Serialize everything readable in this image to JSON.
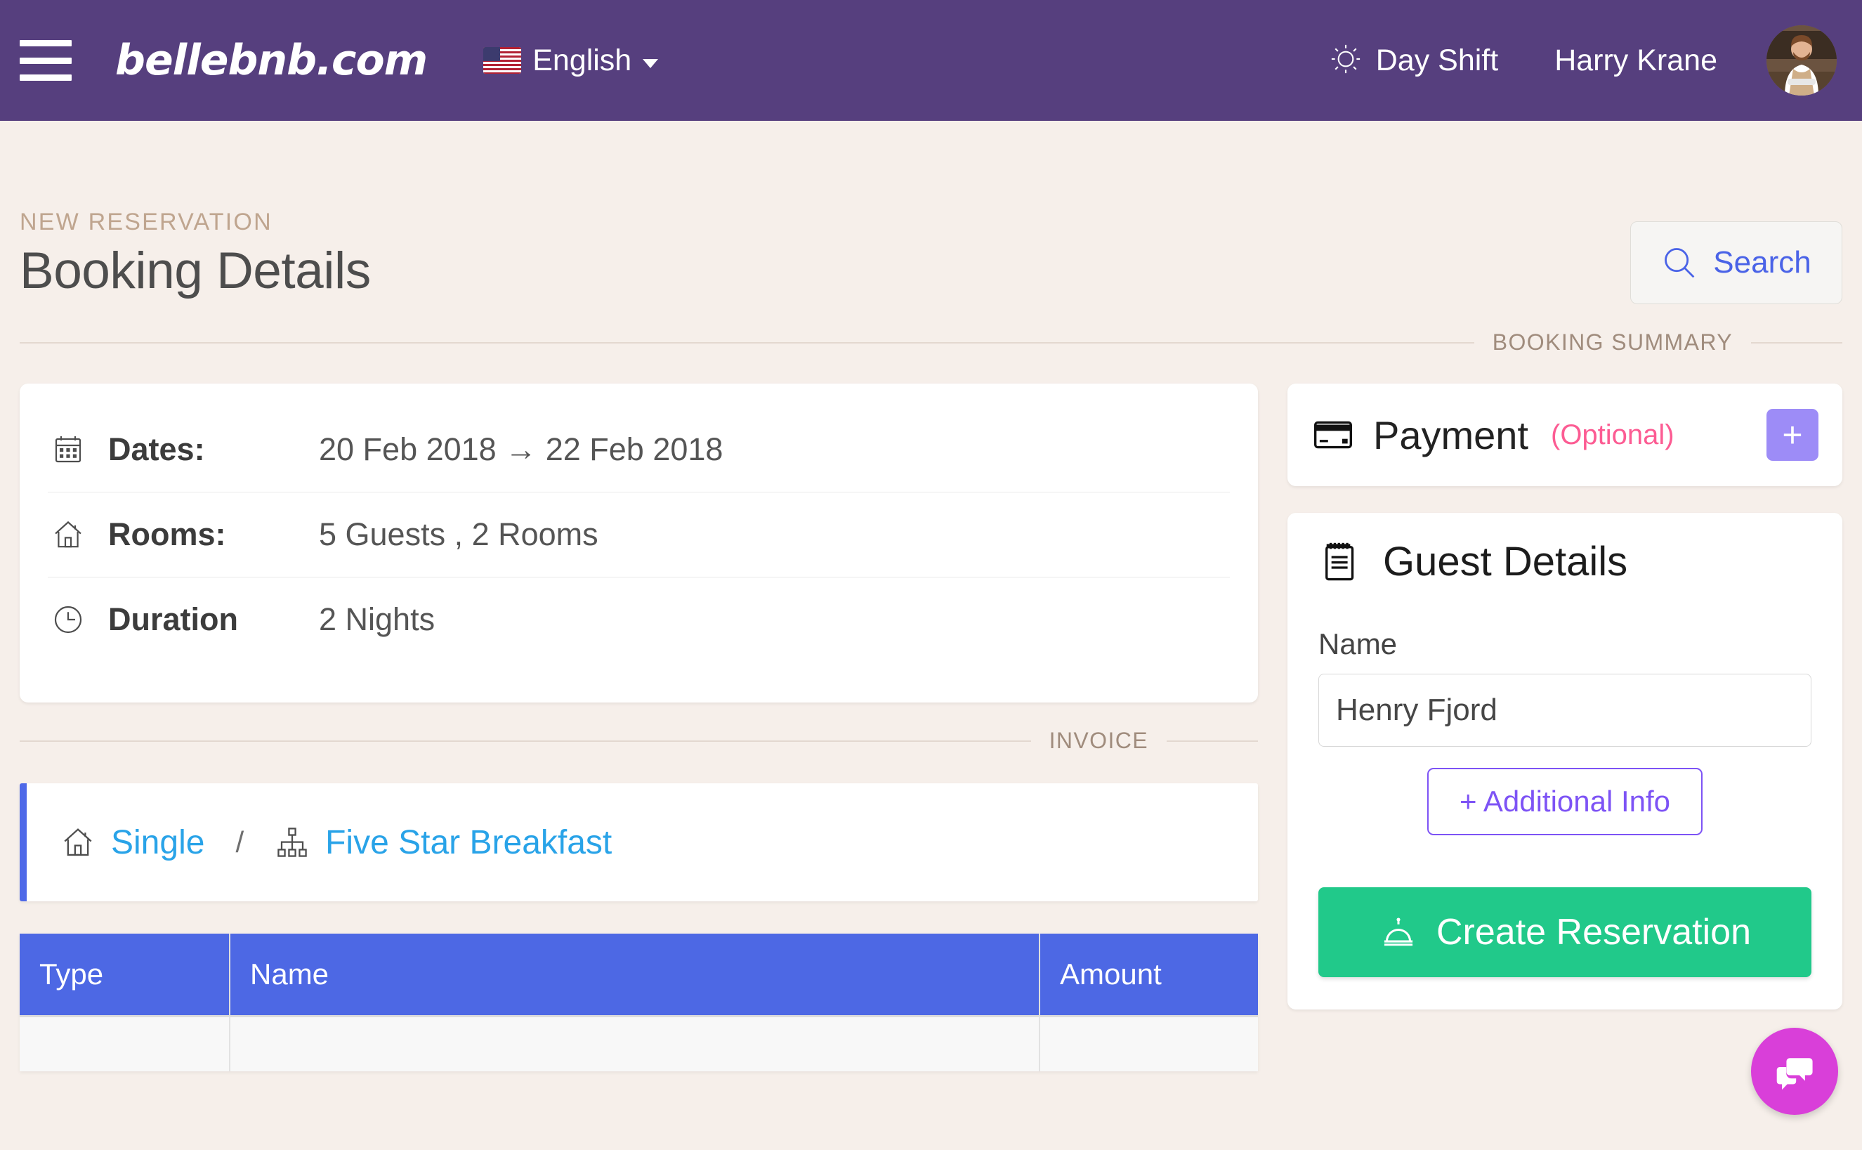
{
  "topnav": {
    "menu_icon": "hamburger-icon",
    "brand": "bellebnb.com",
    "language": "English",
    "language_flag": "us-flag-icon",
    "shift_icon": "sun-icon",
    "shift": "Day Shift",
    "user": "Harry Krane",
    "avatar": "user-avatar"
  },
  "page": {
    "eyebrow": "NEW RESERVATION",
    "title": "Booking Details",
    "search_label": "Search",
    "search_icon": "search-icon"
  },
  "sections": {
    "booking_summary": "BOOKING SUMMARY",
    "invoice": "INVOICE"
  },
  "summary": {
    "rows": [
      {
        "icon": "calendar-icon",
        "label": "Dates:",
        "value": "20 Feb 2018 → 22 Feb 2018"
      },
      {
        "icon": "house-icon",
        "label": "Rooms:",
        "value": "5 Guests , 2 Rooms"
      },
      {
        "icon": "clock-icon",
        "label": "Duration",
        "value": "2 Nights"
      }
    ]
  },
  "invoice": {
    "room_line": {
      "room_icon": "house-icon",
      "room_type": "Single",
      "separator": "/",
      "rate_icon": "sitemap-icon",
      "rate_plan": "Five Star Breakfast"
    },
    "table": {
      "headers": [
        "Type",
        "Name",
        "Amount"
      ],
      "rows": [
        {
          "type": "",
          "name": "",
          "amount": ""
        }
      ]
    }
  },
  "payment": {
    "icon": "credit-card-icon",
    "title": "Payment",
    "optional": "(Optional)",
    "add_label": "+"
  },
  "guest": {
    "icon": "notepad-icon",
    "title": "Guest Details",
    "name_label": "Name",
    "name_value": "Henry Fjord",
    "name_placeholder": "Name",
    "additional_info_label": "+ Additional Info",
    "create_label": "Create Reservation",
    "create_icon": "bell-icon"
  },
  "chat": {
    "icon": "chat-bubbles-icon"
  },
  "colors": {
    "header_purple": "#563f7e",
    "page_background": "#f6efea",
    "accent_blue": "#4e69e8",
    "table_header_blue": "#4d68e4",
    "link_blue": "#4a63e7",
    "room_link_blue": "#29a3e8",
    "eyebrow_tan": "#bfa58f",
    "optional_pink": "#fc5c93",
    "add_purple": "#9d8cf7",
    "outline_purple": "#7d53f5",
    "create_green": "#21c98a",
    "chat_magenta": "#d93fd9"
  }
}
